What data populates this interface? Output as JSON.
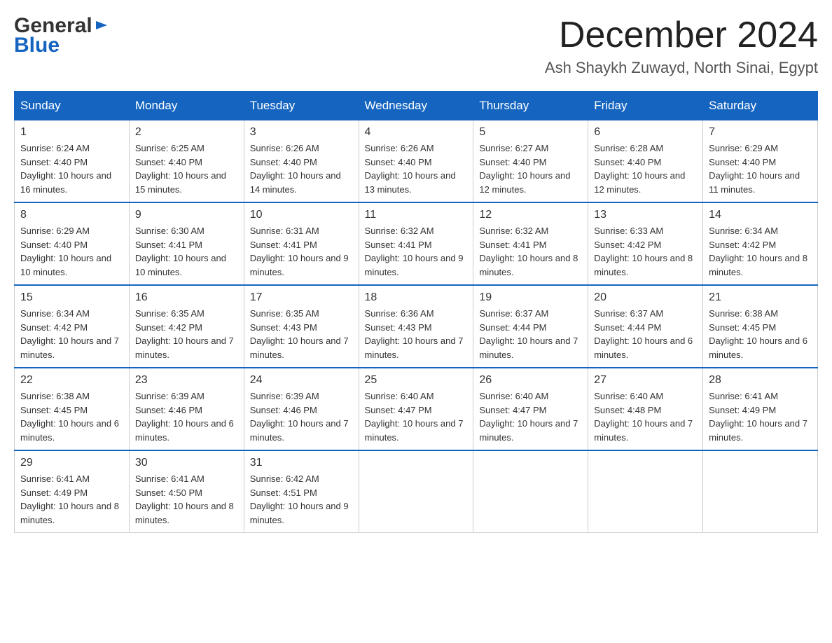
{
  "header": {
    "logo_line1": "General",
    "logo_line2": "Blue",
    "month": "December 2024",
    "location": "Ash Shaykh Zuwayd, North Sinai, Egypt"
  },
  "weekdays": [
    "Sunday",
    "Monday",
    "Tuesday",
    "Wednesday",
    "Thursday",
    "Friday",
    "Saturday"
  ],
  "weeks": [
    [
      {
        "day": "1",
        "sunrise": "6:24 AM",
        "sunset": "4:40 PM",
        "daylight": "10 hours and 16 minutes."
      },
      {
        "day": "2",
        "sunrise": "6:25 AM",
        "sunset": "4:40 PM",
        "daylight": "10 hours and 15 minutes."
      },
      {
        "day": "3",
        "sunrise": "6:26 AM",
        "sunset": "4:40 PM",
        "daylight": "10 hours and 14 minutes."
      },
      {
        "day": "4",
        "sunrise": "6:26 AM",
        "sunset": "4:40 PM",
        "daylight": "10 hours and 13 minutes."
      },
      {
        "day": "5",
        "sunrise": "6:27 AM",
        "sunset": "4:40 PM",
        "daylight": "10 hours and 12 minutes."
      },
      {
        "day": "6",
        "sunrise": "6:28 AM",
        "sunset": "4:40 PM",
        "daylight": "10 hours and 12 minutes."
      },
      {
        "day": "7",
        "sunrise": "6:29 AM",
        "sunset": "4:40 PM",
        "daylight": "10 hours and 11 minutes."
      }
    ],
    [
      {
        "day": "8",
        "sunrise": "6:29 AM",
        "sunset": "4:40 PM",
        "daylight": "10 hours and 10 minutes."
      },
      {
        "day": "9",
        "sunrise": "6:30 AM",
        "sunset": "4:41 PM",
        "daylight": "10 hours and 10 minutes."
      },
      {
        "day": "10",
        "sunrise": "6:31 AM",
        "sunset": "4:41 PM",
        "daylight": "10 hours and 9 minutes."
      },
      {
        "day": "11",
        "sunrise": "6:32 AM",
        "sunset": "4:41 PM",
        "daylight": "10 hours and 9 minutes."
      },
      {
        "day": "12",
        "sunrise": "6:32 AM",
        "sunset": "4:41 PM",
        "daylight": "10 hours and 8 minutes."
      },
      {
        "day": "13",
        "sunrise": "6:33 AM",
        "sunset": "4:42 PM",
        "daylight": "10 hours and 8 minutes."
      },
      {
        "day": "14",
        "sunrise": "6:34 AM",
        "sunset": "4:42 PM",
        "daylight": "10 hours and 8 minutes."
      }
    ],
    [
      {
        "day": "15",
        "sunrise": "6:34 AM",
        "sunset": "4:42 PM",
        "daylight": "10 hours and 7 minutes."
      },
      {
        "day": "16",
        "sunrise": "6:35 AM",
        "sunset": "4:42 PM",
        "daylight": "10 hours and 7 minutes."
      },
      {
        "day": "17",
        "sunrise": "6:35 AM",
        "sunset": "4:43 PM",
        "daylight": "10 hours and 7 minutes."
      },
      {
        "day": "18",
        "sunrise": "6:36 AM",
        "sunset": "4:43 PM",
        "daylight": "10 hours and 7 minutes."
      },
      {
        "day": "19",
        "sunrise": "6:37 AM",
        "sunset": "4:44 PM",
        "daylight": "10 hours and 7 minutes."
      },
      {
        "day": "20",
        "sunrise": "6:37 AM",
        "sunset": "4:44 PM",
        "daylight": "10 hours and 6 minutes."
      },
      {
        "day": "21",
        "sunrise": "6:38 AM",
        "sunset": "4:45 PM",
        "daylight": "10 hours and 6 minutes."
      }
    ],
    [
      {
        "day": "22",
        "sunrise": "6:38 AM",
        "sunset": "4:45 PM",
        "daylight": "10 hours and 6 minutes."
      },
      {
        "day": "23",
        "sunrise": "6:39 AM",
        "sunset": "4:46 PM",
        "daylight": "10 hours and 6 minutes."
      },
      {
        "day": "24",
        "sunrise": "6:39 AM",
        "sunset": "4:46 PM",
        "daylight": "10 hours and 7 minutes."
      },
      {
        "day": "25",
        "sunrise": "6:40 AM",
        "sunset": "4:47 PM",
        "daylight": "10 hours and 7 minutes."
      },
      {
        "day": "26",
        "sunrise": "6:40 AM",
        "sunset": "4:47 PM",
        "daylight": "10 hours and 7 minutes."
      },
      {
        "day": "27",
        "sunrise": "6:40 AM",
        "sunset": "4:48 PM",
        "daylight": "10 hours and 7 minutes."
      },
      {
        "day": "28",
        "sunrise": "6:41 AM",
        "sunset": "4:49 PM",
        "daylight": "10 hours and 7 minutes."
      }
    ],
    [
      {
        "day": "29",
        "sunrise": "6:41 AM",
        "sunset": "4:49 PM",
        "daylight": "10 hours and 8 minutes."
      },
      {
        "day": "30",
        "sunrise": "6:41 AM",
        "sunset": "4:50 PM",
        "daylight": "10 hours and 8 minutes."
      },
      {
        "day": "31",
        "sunrise": "6:42 AM",
        "sunset": "4:51 PM",
        "daylight": "10 hours and 9 minutes."
      },
      null,
      null,
      null,
      null
    ]
  ],
  "labels": {
    "sunrise_prefix": "Sunrise: ",
    "sunset_prefix": "Sunset: ",
    "daylight_prefix": "Daylight: "
  }
}
